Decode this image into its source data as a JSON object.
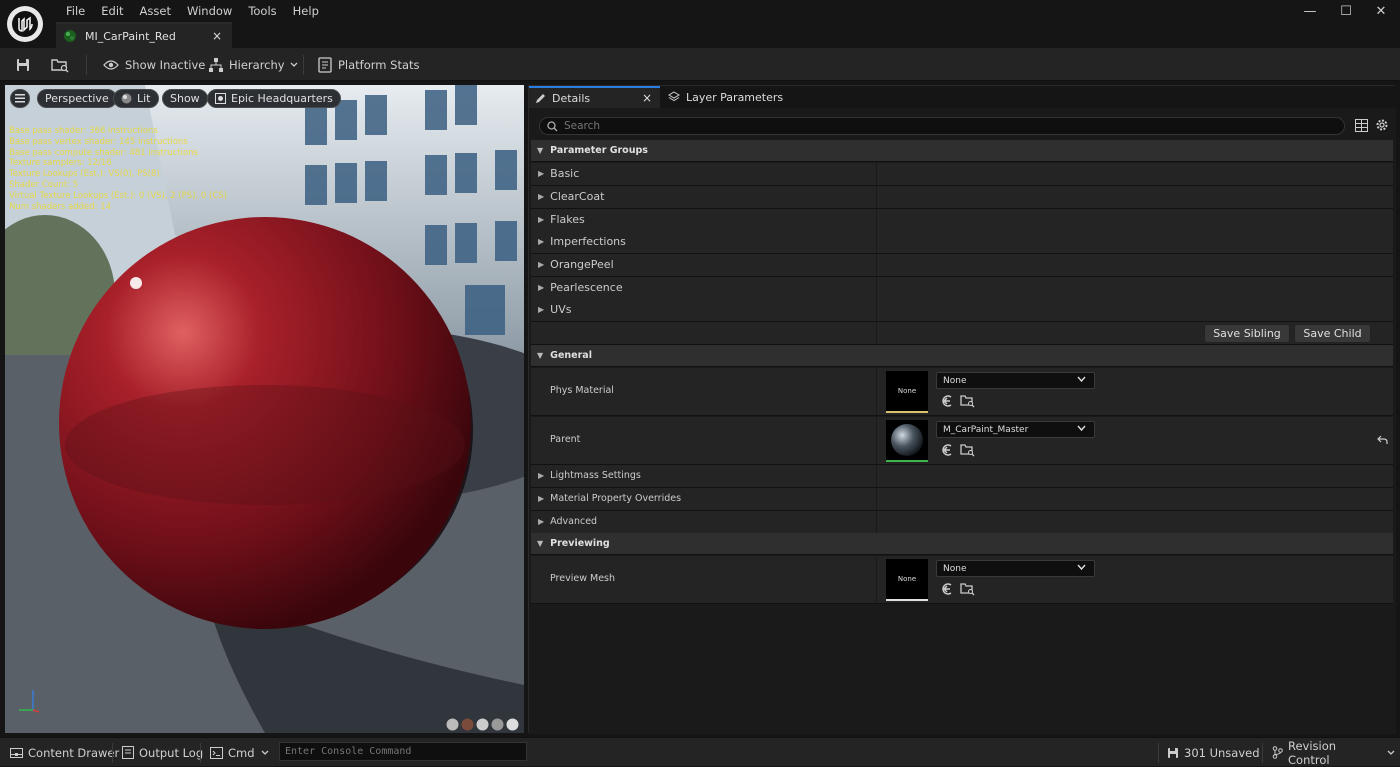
{
  "menu": [
    "File",
    "Edit",
    "Asset",
    "Window",
    "Tools",
    "Help"
  ],
  "asset_tab": {
    "label": "MI_CarPaint_Red",
    "close": "×"
  },
  "window_controls": {
    "minimize": "—",
    "maximize": "☐",
    "close": "✕"
  },
  "toolbar": {
    "show_inactive": "Show Inactive",
    "hierarchy": "Hierarchy",
    "platform_stats": "Platform Stats"
  },
  "viewport": {
    "perspective": "Perspective",
    "lit": "Lit",
    "show": "Show",
    "environment": "Epic Headquarters",
    "stats": [
      "Base pass shader: 366 instructions",
      "Base pass vertex shader: 145 instructions",
      "Base pass compute shader: 481 instructions",
      "Texture samplers: 12/16",
      "Texture Lookups (Est.): VS(0), PS(8)",
      "Shader Count: 5",
      "Virtual Texture Lookups (Est.): 0 (VS), 2 (PS), 0 (CS)",
      "Num shaders added: 14"
    ]
  },
  "details": {
    "tab_details": "Details",
    "tab_layer": "Layer Parameters",
    "tab_close": "×",
    "search_placeholder": "Search",
    "param_groups_header": "Parameter Groups",
    "groups": [
      "Basic",
      "ClearCoat",
      "Flakes",
      "Imperfections",
      "OrangePeel",
      "Pearlescence",
      "UVs"
    ],
    "save_sibling": "Save Sibling",
    "save_child": "Save Child",
    "general_header": "General",
    "phys_material": {
      "label": "Phys Material",
      "thumb": "None",
      "value": "None"
    },
    "parent": {
      "label": "Parent",
      "value": "M_CarPaint_Master"
    },
    "collapsed": [
      "Lightmass Settings",
      "Material Property Overrides",
      "Advanced"
    ],
    "previewing_header": "Previewing",
    "preview_mesh": {
      "label": "Preview Mesh",
      "thumb": "None",
      "value": "None"
    }
  },
  "bottombar": {
    "content_drawer": "Content Drawer",
    "output_log": "Output Log",
    "cmd": "Cmd",
    "console_placeholder": "Enter Console Command",
    "unsaved": "301 Unsaved",
    "revision_control": "Revision Control"
  },
  "colors": {
    "accent": "#2a7de1",
    "stats_text": "#e6d84a",
    "panel": "#242424",
    "background": "#151515"
  }
}
